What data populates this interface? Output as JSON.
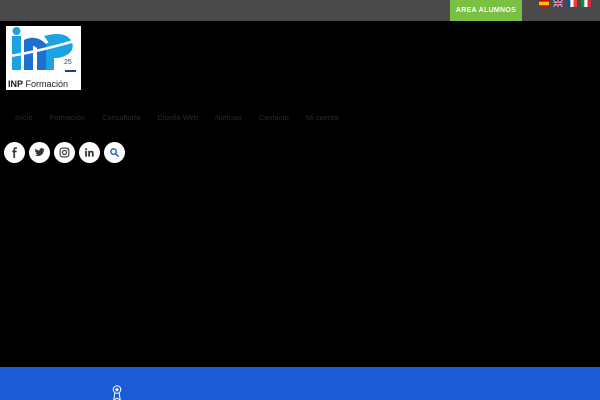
{
  "topbar": {
    "area_button_label": "AREA ALUMNOS",
    "accent_color": "#7ac143",
    "flags": [
      "spanish-flag-icon",
      "uk-flag-icon",
      "french-flag-icon",
      "italian-flag-icon"
    ]
  },
  "logo": {
    "brand": "INP",
    "name": "Formación",
    "badge_number": "25"
  },
  "nav": {
    "items": [
      "Inicio",
      "Formación",
      "Consultoría",
      "Diseño Web",
      "Noticias",
      "Contacto",
      "Mi cuenta"
    ]
  },
  "social": {
    "icons": [
      "facebook-icon",
      "twitter-icon",
      "instagram-icon",
      "linkedin-icon",
      "search-icon"
    ]
  },
  "colors": {
    "background": "#000000",
    "topbar": "#4a4a4a",
    "footer_band": "#1c5bd6"
  }
}
